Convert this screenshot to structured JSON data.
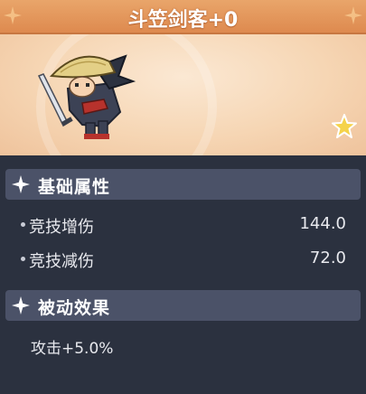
{
  "title": "斗笠剑客+0",
  "sections": {
    "attributes": {
      "label": "基础属性",
      "stats": [
        {
          "name": "竞技增伤",
          "value": "144.0"
        },
        {
          "name": "竞技减伤",
          "value": "72.0"
        }
      ]
    },
    "passive": {
      "label": "被动效果",
      "effect": "攻击+5.0%"
    }
  },
  "icons": {
    "corner": "sparkle-icon",
    "section": "sparkle-icon",
    "rank": "star-icon",
    "hero": "bamboo-hat-swordsman-sprite"
  },
  "colors": {
    "title_bar": "#de8a4f",
    "section_header": "#4b5268",
    "panel_background": "#2b313f",
    "portrait_background": "#f6d6b4",
    "rank_star": "#f5d34a"
  }
}
